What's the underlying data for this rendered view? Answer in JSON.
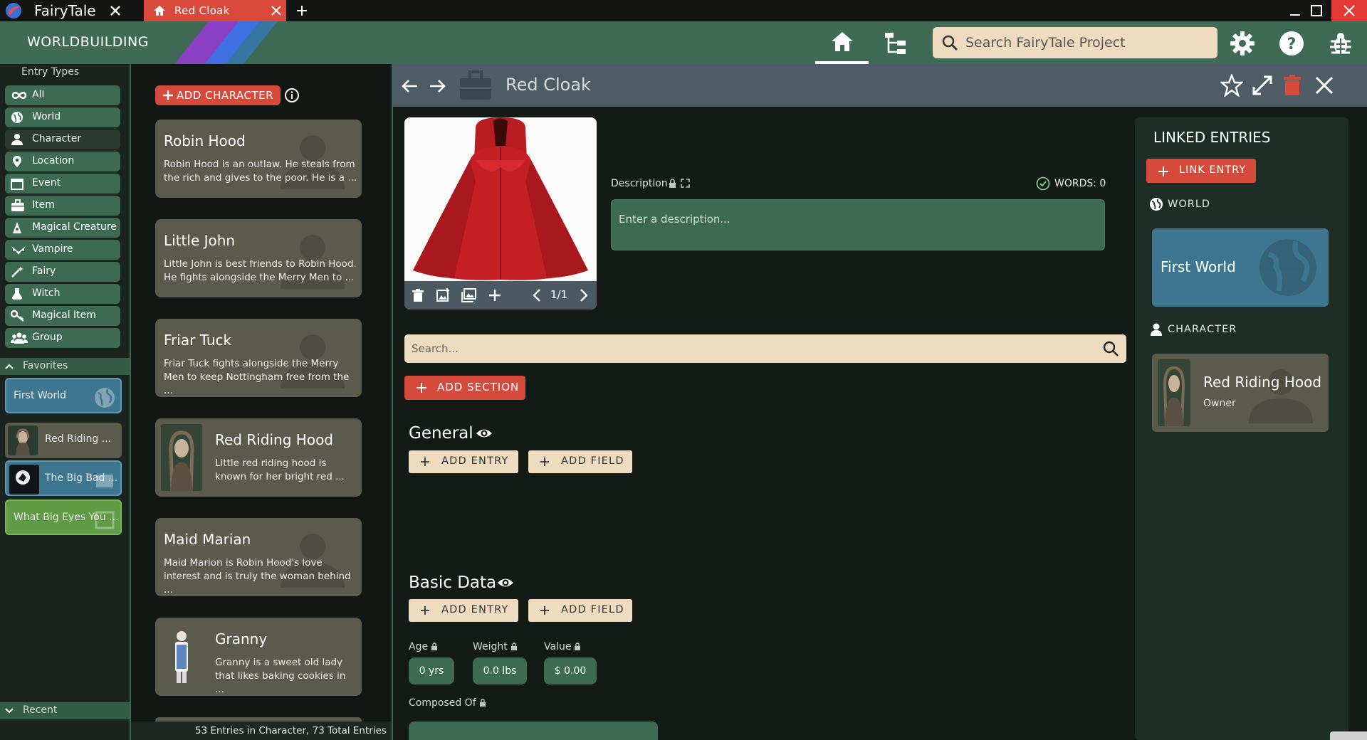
{
  "titlebar": {
    "app_name": "FairyTale",
    "tab_label": "Red Cloak"
  },
  "header": {
    "section_title": "WORLDBUILDING",
    "search_placeholder": "Search FairyTale Project"
  },
  "sidebar": {
    "entry_types_label": "Entry Types",
    "types": [
      {
        "label": "All",
        "icon": "infinity-icon"
      },
      {
        "label": "World",
        "icon": "globe-icon"
      },
      {
        "label": "Character",
        "icon": "person-icon"
      },
      {
        "label": "Location",
        "icon": "pin-icon"
      },
      {
        "label": "Event",
        "icon": "calendar-icon"
      },
      {
        "label": "Item",
        "icon": "briefcase-icon"
      },
      {
        "label": "Magical Creature",
        "icon": "creature-icon"
      },
      {
        "label": "Vampire",
        "icon": "bat-icon"
      },
      {
        "label": "Fairy",
        "icon": "wand-icon"
      },
      {
        "label": "Witch",
        "icon": "potion-icon"
      },
      {
        "label": "Magical Item",
        "icon": "key-icon"
      },
      {
        "label": "Group",
        "icon": "group-icon"
      }
    ],
    "favorites_label": "Favorites",
    "favorites": [
      {
        "label": "First World",
        "color": "#3e7690"
      },
      {
        "label": "Red Riding ...",
        "color": "#5a5a4d"
      },
      {
        "label": "The Big Bad ...",
        "color": "#3e7690"
      },
      {
        "label": "What Big Eyes You ...",
        "color": "#5f9a45"
      }
    ],
    "recent_label": "Recent"
  },
  "list": {
    "add_label": "ADD CHARACTER",
    "cards": [
      {
        "name": "Robin Hood",
        "desc": "Robin Hood is an outlaw. He steals from the rich and gives to the poor. He is a ..."
      },
      {
        "name": "Little John",
        "desc": "Little John is best friends to Robin Hood. He fights alongside the Merry Men to ..."
      },
      {
        "name": "Friar Tuck",
        "desc": "Friar Tuck fights alongside the Merry Men to keep Nottingham free from the ..."
      },
      {
        "name": "Red Riding Hood",
        "desc": "Little red riding hood is known for her bright red ..."
      },
      {
        "name": "Maid Marian",
        "desc": "Maid Marion is Robin Hood's love interest and is truly the woman behind ..."
      },
      {
        "name": "Granny",
        "desc": "Granny is a sweet old lady that likes baking cookies in ..."
      }
    ],
    "footer": "53 Entries in Character, 73 Total Entries"
  },
  "main": {
    "title": "Red Cloak",
    "image_page": "1/1",
    "description_label": "Description",
    "words_label": "WORDS: 0",
    "description_placeholder": "Enter a description...",
    "search_placeholder": "Search...",
    "add_section_label": "ADD SECTION",
    "sections": [
      {
        "title": "General",
        "add_entry": "ADD ENTRY",
        "add_field": "ADD FIELD"
      },
      {
        "title": "Basic Data",
        "add_entry": "ADD ENTRY",
        "add_field": "ADD FIELD"
      }
    ],
    "fields": [
      {
        "label": "Age",
        "value": "0 yrs"
      },
      {
        "label": "Weight",
        "value": "0.0 lbs"
      },
      {
        "label": "Value",
        "value": "$ 0.00"
      }
    ],
    "composed_label": "Composed Of"
  },
  "linked": {
    "title": "LINKED ENTRIES",
    "link_label": "LINK ENTRY",
    "world_category": "WORLD",
    "world_entry": "First World",
    "character_category": "CHARACTER",
    "character_entry": "Red Riding Hood",
    "character_role": "Owner"
  },
  "colors": {
    "accent_red": "#d64a3c",
    "header_green": "#3f6a55",
    "card_olive": "#5a5a4d",
    "beige": "#efdcc0"
  }
}
